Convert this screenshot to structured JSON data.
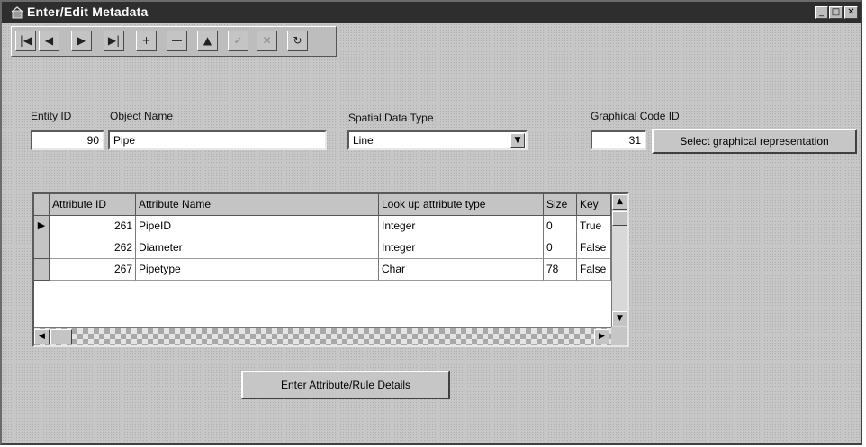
{
  "window": {
    "title": "Enter/Edit Metadata",
    "controls": {
      "minimize": "_",
      "maximize": "□",
      "close": "✕"
    }
  },
  "toolbar": {
    "buttons": [
      {
        "name": "first-record",
        "glyph": "|◀"
      },
      {
        "name": "previous-record",
        "glyph": "◀"
      },
      {
        "name": "next-record",
        "glyph": "▶"
      },
      {
        "name": "last-record",
        "glyph": "▶|"
      },
      {
        "name": "insert-record",
        "glyph": "+"
      },
      {
        "name": "delete-record",
        "glyph": "—"
      },
      {
        "name": "edit-record",
        "glyph": "▲"
      },
      {
        "name": "post-edit",
        "glyph": "✓"
      },
      {
        "name": "cancel-edit",
        "glyph": "✕"
      },
      {
        "name": "refresh-data",
        "glyph": "↻"
      }
    ]
  },
  "form": {
    "entity_id_label": "Entity ID",
    "entity_id_value": "90",
    "object_name_label": "Object Name",
    "object_name_value": "Pipe",
    "spatial_type_label": "Spatial Data Type",
    "spatial_type_value": "Line",
    "graphical_code_label": "Graphical Code ID",
    "graphical_code_value": "31",
    "select_graphical_button": "Select graphical representation"
  },
  "grid": {
    "columns": [
      "Attribute ID",
      "Attribute Name",
      "Look up attribute type",
      "Size",
      "Key"
    ],
    "rows": [
      {
        "id": "261",
        "name": "PipeID",
        "type": "Integer",
        "size": "0",
        "key": "True"
      },
      {
        "id": "262",
        "name": "Diameter",
        "type": "Integer",
        "size": "0",
        "key": "False"
      },
      {
        "id": "267",
        "name": "Pipetype",
        "type": "Char",
        "size": "78",
        "key": "False"
      }
    ],
    "current_row_indicator": "▶"
  },
  "actions": {
    "enter_details_button": "Enter Attribute/Rule Details"
  }
}
